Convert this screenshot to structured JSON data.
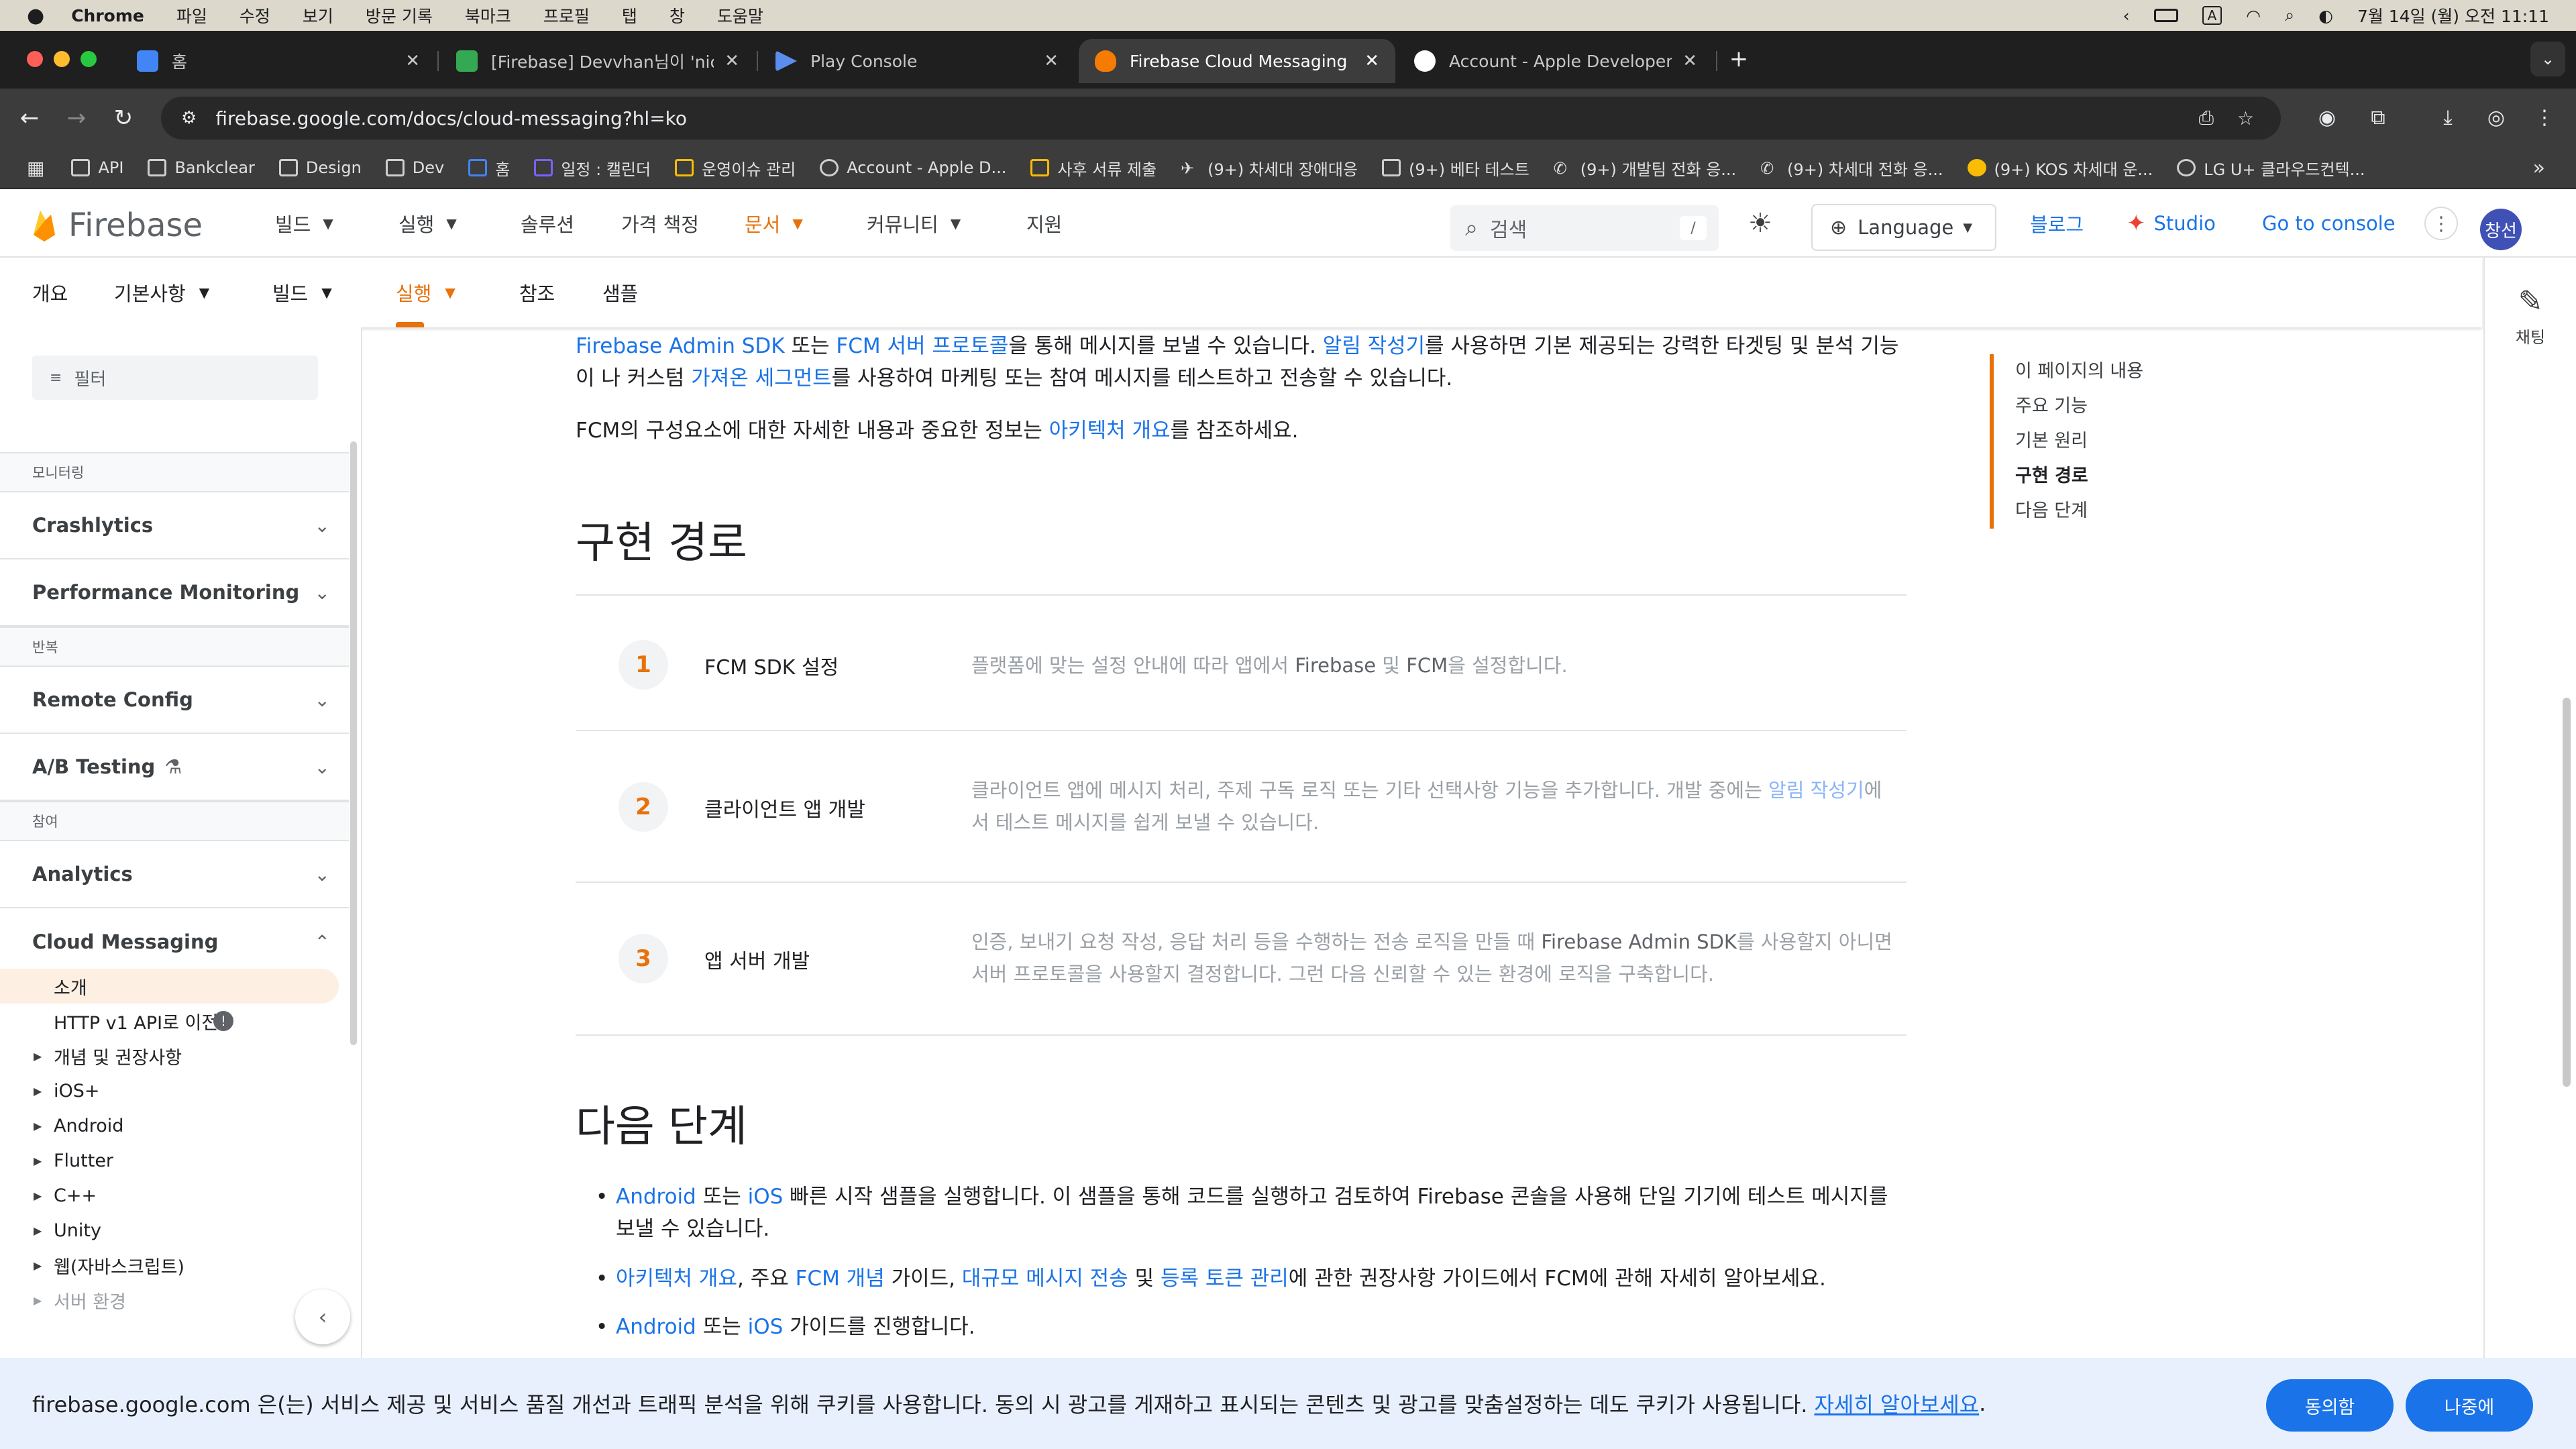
{
  "menubar": {
    "app": "Chrome",
    "items": [
      "파일",
      "수정",
      "보기",
      "방문 기록",
      "북마크",
      "프로필",
      "탭",
      "창",
      "도움말"
    ],
    "clock": "7월 14일 (월) 오전 11:11",
    "input_mode": "A"
  },
  "tabs": [
    {
      "label": "홈",
      "color": "#4285f4"
    },
    {
      "label": "[Firebase] Devvhan님이 'nice-",
      "color": "#34a853"
    },
    {
      "label": "Play Console",
      "color": "#5b8def"
    },
    {
      "label": "Firebase Cloud Messaging",
      "color": "#f57c00",
      "active": true
    },
    {
      "label": "Account - Apple Developer",
      "color": "#ffffff"
    }
  ],
  "toolbar": {
    "url": "firebase.google.com/docs/cloud-messaging?hl=ko"
  },
  "bookmarks": [
    "API",
    "Bankclear",
    "Design",
    "Dev",
    "홈",
    "일정 : 캘린더",
    "운영이슈 관리",
    "Account - Apple D...",
    "사후 서류 제출",
    "(9+) 차세대 장애대응",
    "(9+) 베타 테스트",
    "(9+) 개발팀 전화 응...",
    "(9+) 차세대 전화 응...",
    "(9+) KOS 차세대 운...",
    "LG U+ 클라우드컨텍..."
  ],
  "header": {
    "brand": "Firebase",
    "nav": [
      "빌드",
      "실행",
      "솔루션",
      "가격 책정",
      "문서",
      "커뮤니티",
      "지원"
    ],
    "search_placeholder": "검색",
    "search_key": "/",
    "language": "Language",
    "blog": "블로그",
    "studio": "Studio",
    "console": "Go to console",
    "avatar": "창선"
  },
  "subnav": [
    "개요",
    "기본사항",
    "빌드",
    "실행",
    "참조",
    "샘플"
  ],
  "rail": {
    "chat": "채팅"
  },
  "sidebar": {
    "filter": "필터",
    "sec_monitoring": "모니터링",
    "crashlytics": "Crashlytics",
    "perf": "Performance Monitoring",
    "sec_release": "반복",
    "remote_config": "Remote Config",
    "ab_testing": "A/B Testing",
    "sec_engage": "참여",
    "analytics": "Analytics",
    "fcm": "Cloud Messaging",
    "leaves": [
      "소개",
      "HTTP v1 API로 이전",
      "개념 및 권장사항",
      "iOS+",
      "Android",
      "Flutter",
      "C++",
      "Unity",
      "웹(자바스크립트)",
      "서버 환경"
    ]
  },
  "main": {
    "intro": {
      "l1": "Firebase Admin SDK",
      "t1": " 또는 ",
      "l2": "FCM 서버 프로토콜",
      "t2": "을 통해 메시지를 보낼 수 있습니다. ",
      "l3": "알림 작성기",
      "t3": "를 사용하면 기본 제공되는 강력한 타겟팅 및 분석 기능이 나 커스텀 ",
      "l4": "가져온 세그먼트",
      "t4": "를 사용하여 마케팅 또는 참여 메시지를 테스트하고 전송할 수 있습니다."
    },
    "arch": {
      "t1": "FCM의 구성요소에 대한 자세한 내용과 중요한 정보는 ",
      "l1": "아키텍처 개요",
      "t2": "를 참조하세요."
    },
    "h_path": "구현 경로",
    "steps": [
      {
        "num": "1",
        "title": "FCM SDK 설정",
        "d1": "플랫폼에 맞는 설정 안내에 따라 앱에서 ",
        "d2": "Firebase",
        "d3": " 및 ",
        "d4": "FCM",
        "d5": "을 설정합니다."
      },
      {
        "num": "2",
        "title": "클라이언트 앱 개발",
        "d1": "클라이언트 앱에 메시지 처리, 주제 구독 로직 또는 기타 선택사항 기능을 추가합니다. 개발 중에는 ",
        "d2": "알림 작성기",
        "d3": "에서 테스트 메시지를 쉽게 보낼 수 있습니다."
      },
      {
        "num": "3",
        "title": "앱 서버 개발",
        "d1": "인증, 보내기 요청 작성, 응답 처리 등을 수행하는 전송 로직을 만들 때 ",
        "d2": "Firebase Admin SDK",
        "d3": "를 사용할지 아니면 서버 프로토콜을 사용할지 결정합니다. 그런 다음 신뢰할 수 있는 환경에 로직을 구축합니다."
      }
    ],
    "h_next": "다음 단계",
    "b1": {
      "l1": "Android",
      "t1": " 또는 ",
      "l2": "iOS",
      "t2": " 빠른 시작 샘플을 실행합니다. 이 샘플을 통해 코드를 실행하고 검토하여 Firebase 콘솔을 사용해 단일 기기에 테스트 메시지를 보낼 수 있습니다."
    },
    "b2": {
      "l1": "아키텍처 개요",
      "t1": ", 주요 ",
      "l2": "FCM 개념",
      "t2": " 가이드, ",
      "l3": "대규모 메시지 전송",
      "t3": " 및 ",
      "l4": "등록 토큰 관리",
      "t4": "에 관한 권장사항 가이드에서 FCM에 관해 자세히 알아보세요."
    },
    "b3": {
      "l1": "Android",
      "t1": " 또는 ",
      "l2": "iOS",
      "t2": " 가이드를 진행합니다."
    }
  },
  "toc": [
    "이 페이지의 내용",
    "주요 기능",
    "기본 원리",
    "구현 경로",
    "다음 단계"
  ],
  "cookie": {
    "text": "firebase.google.com 은(는) 서비스 제공 및 서비스 품질 개선과 트래픽 분석을 위해 쿠키를 사용합니다. 동의 시 광고를 게재하고 표시되는 콘텐츠 및 광고를 맞춤설정하는 데도 쿠키가 사용됩니다. ",
    "link": "자세히 알아보세요",
    "end": ".",
    "agree": "동의함",
    "later": "나중에"
  },
  "colors": {
    "accent": "#e8710a",
    "link": "#1a73e8",
    "cookie_bg": "#e8f0fe"
  }
}
